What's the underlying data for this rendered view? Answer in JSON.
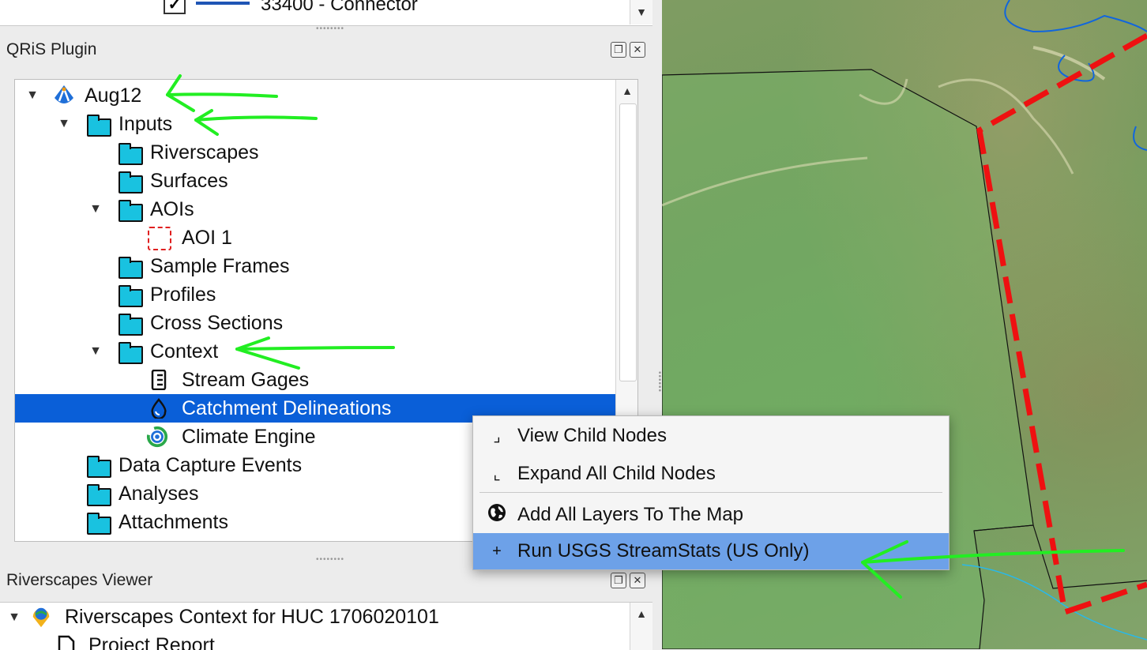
{
  "legend_top": {
    "checkbox": "✓",
    "label": "33400 - Connector",
    "line_color": "#1f55b5"
  },
  "qris_panel": {
    "title": "QRiS Plugin"
  },
  "tree": {
    "root": {
      "label": "Aug12"
    },
    "items": [
      {
        "label": "Inputs"
      },
      {
        "label": "Riverscapes"
      },
      {
        "label": "Surfaces"
      },
      {
        "label": "AOIs"
      },
      {
        "label": "AOI 1"
      },
      {
        "label": "Sample Frames"
      },
      {
        "label": "Profiles"
      },
      {
        "label": "Cross Sections"
      },
      {
        "label": "Context"
      },
      {
        "label": "Stream Gages"
      },
      {
        "label": "Catchment Delineations"
      },
      {
        "label": "Climate Engine"
      },
      {
        "label": "Data Capture Events"
      },
      {
        "label": "Analyses"
      },
      {
        "label": "Attachments"
      }
    ],
    "selected_color": "#0a5fd8"
  },
  "context_menu": {
    "items": [
      {
        "label": "View Child Nodes",
        "icon": "collapse-icon"
      },
      {
        "label": "Expand All Child Nodes",
        "icon": "expand-icon"
      },
      {
        "label": "Add All Layers To The Map",
        "icon": "globe-icon"
      },
      {
        "label": "Run USGS StreamStats (US Only)",
        "icon": "plus-icon"
      }
    ],
    "highlight_color": "#6da1e8"
  },
  "viewer_panel": {
    "title": "Riverscapes Viewer",
    "items": [
      {
        "label": "Riverscapes Context for HUC 1706020101"
      },
      {
        "label": "Project Report"
      }
    ]
  },
  "colors": {
    "annotation_arrow": "#22ee22",
    "boundary_red": "#ee1111",
    "stream_blue": "#1166dd"
  }
}
